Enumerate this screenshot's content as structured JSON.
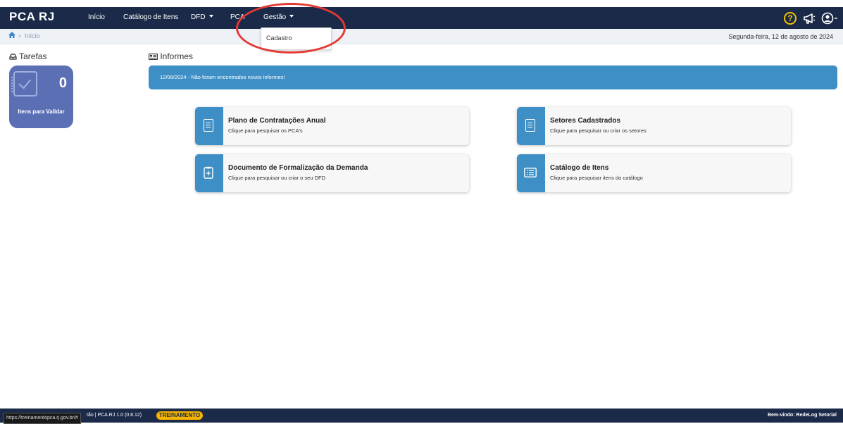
{
  "navbar": {
    "brand": "PCA RJ",
    "items": [
      {
        "label": "Início"
      },
      {
        "label": "Catálogo de Itens"
      },
      {
        "label": "DFD"
      },
      {
        "label": "PCA"
      },
      {
        "label": "Gestão"
      }
    ],
    "help_glyph": "?",
    "icons": [
      "question-icon",
      "megaphone-icon",
      "user-circle-icon"
    ]
  },
  "breadcrumb": {
    "separator": ">",
    "current": "Início"
  },
  "date": "Segunda-feira, 12 de agosto de 2024",
  "dropdown": {
    "items": [
      {
        "label": "Cadastro"
      }
    ]
  },
  "tasks": {
    "title": "Tarefas",
    "card": {
      "count": "0",
      "label": "Itens para Validar"
    }
  },
  "informes": {
    "title": "Informes",
    "message": "12/08/2024 - Não foram encontrados novos informes!"
  },
  "cards": [
    {
      "title": "Plano de Contratações Anual",
      "subtitle": "Clique para pesquisar os PCA's"
    },
    {
      "title": "Setores Cadastrados",
      "subtitle": "Clique para pesquisar ou criar os setores"
    },
    {
      "title": "Documento de Formalização da Demanda",
      "subtitle": "Clique para pesquisar ou criar o seu DFD"
    },
    {
      "title": "Catálogo de Itens",
      "subtitle": "Clique para pesquisar itens do catálogo"
    }
  ],
  "footer": {
    "url": "https://treinamentopca.rj.gov.br/#",
    "version_text": "tão | PCA.RJ 1.0 (0.8.12)",
    "badge": "TREINAMENTO",
    "welcome": "Bem-vindo: RedeLog Setorial"
  },
  "colors": {
    "navbar": "#1b2a48",
    "accent": "#3e8fc5",
    "task_card": "#5b6fb5",
    "badge": "#f4b400",
    "highlight": "#e53935"
  }
}
